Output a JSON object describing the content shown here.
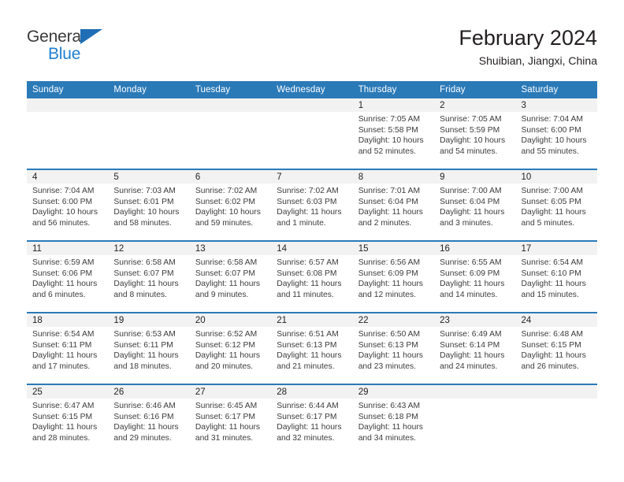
{
  "brand": {
    "name_top": "General",
    "name_bottom": "Blue",
    "triangle_color": "#1f6eb5",
    "text_color": "#3a3a3a",
    "blue_color": "#1f7fd0"
  },
  "header": {
    "title": "February 2024",
    "location": "Shuibian, Jiangxi, China"
  },
  "theme": {
    "header_bg": "#2b7ab8",
    "header_text": "#ffffff",
    "num_band_bg": "#f2f2f2",
    "row_divider": "#2b7ab8",
    "body_text": "#3c3c3c"
  },
  "weekday_headers": [
    "Sunday",
    "Monday",
    "Tuesday",
    "Wednesday",
    "Thursday",
    "Friday",
    "Saturday"
  ],
  "labels": {
    "sunrise_prefix": "Sunrise:",
    "sunset_prefix": "Sunset:",
    "daylight_prefix": "Daylight:"
  },
  "weeks": [
    [
      {
        "day": "",
        "lines": []
      },
      {
        "day": "",
        "lines": []
      },
      {
        "day": "",
        "lines": []
      },
      {
        "day": "",
        "lines": []
      },
      {
        "day": "1",
        "lines": [
          "Sunrise: 7:05 AM",
          "Sunset: 5:58 PM",
          "Daylight: 10 hours",
          "and 52 minutes."
        ]
      },
      {
        "day": "2",
        "lines": [
          "Sunrise: 7:05 AM",
          "Sunset: 5:59 PM",
          "Daylight: 10 hours",
          "and 54 minutes."
        ]
      },
      {
        "day": "3",
        "lines": [
          "Sunrise: 7:04 AM",
          "Sunset: 6:00 PM",
          "Daylight: 10 hours",
          "and 55 minutes."
        ]
      }
    ],
    [
      {
        "day": "4",
        "lines": [
          "Sunrise: 7:04 AM",
          "Sunset: 6:00 PM",
          "Daylight: 10 hours",
          "and 56 minutes."
        ]
      },
      {
        "day": "5",
        "lines": [
          "Sunrise: 7:03 AM",
          "Sunset: 6:01 PM",
          "Daylight: 10 hours",
          "and 58 minutes."
        ]
      },
      {
        "day": "6",
        "lines": [
          "Sunrise: 7:02 AM",
          "Sunset: 6:02 PM",
          "Daylight: 10 hours",
          "and 59 minutes."
        ]
      },
      {
        "day": "7",
        "lines": [
          "Sunrise: 7:02 AM",
          "Sunset: 6:03 PM",
          "Daylight: 11 hours",
          "and 1 minute."
        ]
      },
      {
        "day": "8",
        "lines": [
          "Sunrise: 7:01 AM",
          "Sunset: 6:04 PM",
          "Daylight: 11 hours",
          "and 2 minutes."
        ]
      },
      {
        "day": "9",
        "lines": [
          "Sunrise: 7:00 AM",
          "Sunset: 6:04 PM",
          "Daylight: 11 hours",
          "and 3 minutes."
        ]
      },
      {
        "day": "10",
        "lines": [
          "Sunrise: 7:00 AM",
          "Sunset: 6:05 PM",
          "Daylight: 11 hours",
          "and 5 minutes."
        ]
      }
    ],
    [
      {
        "day": "11",
        "lines": [
          "Sunrise: 6:59 AM",
          "Sunset: 6:06 PM",
          "Daylight: 11 hours",
          "and 6 minutes."
        ]
      },
      {
        "day": "12",
        "lines": [
          "Sunrise: 6:58 AM",
          "Sunset: 6:07 PM",
          "Daylight: 11 hours",
          "and 8 minutes."
        ]
      },
      {
        "day": "13",
        "lines": [
          "Sunrise: 6:58 AM",
          "Sunset: 6:07 PM",
          "Daylight: 11 hours",
          "and 9 minutes."
        ]
      },
      {
        "day": "14",
        "lines": [
          "Sunrise: 6:57 AM",
          "Sunset: 6:08 PM",
          "Daylight: 11 hours",
          "and 11 minutes."
        ]
      },
      {
        "day": "15",
        "lines": [
          "Sunrise: 6:56 AM",
          "Sunset: 6:09 PM",
          "Daylight: 11 hours",
          "and 12 minutes."
        ]
      },
      {
        "day": "16",
        "lines": [
          "Sunrise: 6:55 AM",
          "Sunset: 6:09 PM",
          "Daylight: 11 hours",
          "and 14 minutes."
        ]
      },
      {
        "day": "17",
        "lines": [
          "Sunrise: 6:54 AM",
          "Sunset: 6:10 PM",
          "Daylight: 11 hours",
          "and 15 minutes."
        ]
      }
    ],
    [
      {
        "day": "18",
        "lines": [
          "Sunrise: 6:54 AM",
          "Sunset: 6:11 PM",
          "Daylight: 11 hours",
          "and 17 minutes."
        ]
      },
      {
        "day": "19",
        "lines": [
          "Sunrise: 6:53 AM",
          "Sunset: 6:11 PM",
          "Daylight: 11 hours",
          "and 18 minutes."
        ]
      },
      {
        "day": "20",
        "lines": [
          "Sunrise: 6:52 AM",
          "Sunset: 6:12 PM",
          "Daylight: 11 hours",
          "and 20 minutes."
        ]
      },
      {
        "day": "21",
        "lines": [
          "Sunrise: 6:51 AM",
          "Sunset: 6:13 PM",
          "Daylight: 11 hours",
          "and 21 minutes."
        ]
      },
      {
        "day": "22",
        "lines": [
          "Sunrise: 6:50 AM",
          "Sunset: 6:13 PM",
          "Daylight: 11 hours",
          "and 23 minutes."
        ]
      },
      {
        "day": "23",
        "lines": [
          "Sunrise: 6:49 AM",
          "Sunset: 6:14 PM",
          "Daylight: 11 hours",
          "and 24 minutes."
        ]
      },
      {
        "day": "24",
        "lines": [
          "Sunrise: 6:48 AM",
          "Sunset: 6:15 PM",
          "Daylight: 11 hours",
          "and 26 minutes."
        ]
      }
    ],
    [
      {
        "day": "25",
        "lines": [
          "Sunrise: 6:47 AM",
          "Sunset: 6:15 PM",
          "Daylight: 11 hours",
          "and 28 minutes."
        ]
      },
      {
        "day": "26",
        "lines": [
          "Sunrise: 6:46 AM",
          "Sunset: 6:16 PM",
          "Daylight: 11 hours",
          "and 29 minutes."
        ]
      },
      {
        "day": "27",
        "lines": [
          "Sunrise: 6:45 AM",
          "Sunset: 6:17 PM",
          "Daylight: 11 hours",
          "and 31 minutes."
        ]
      },
      {
        "day": "28",
        "lines": [
          "Sunrise: 6:44 AM",
          "Sunset: 6:17 PM",
          "Daylight: 11 hours",
          "and 32 minutes."
        ]
      },
      {
        "day": "29",
        "lines": [
          "Sunrise: 6:43 AM",
          "Sunset: 6:18 PM",
          "Daylight: 11 hours",
          "and 34 minutes."
        ]
      },
      {
        "day": "",
        "lines": []
      },
      {
        "day": "",
        "lines": []
      }
    ]
  ]
}
